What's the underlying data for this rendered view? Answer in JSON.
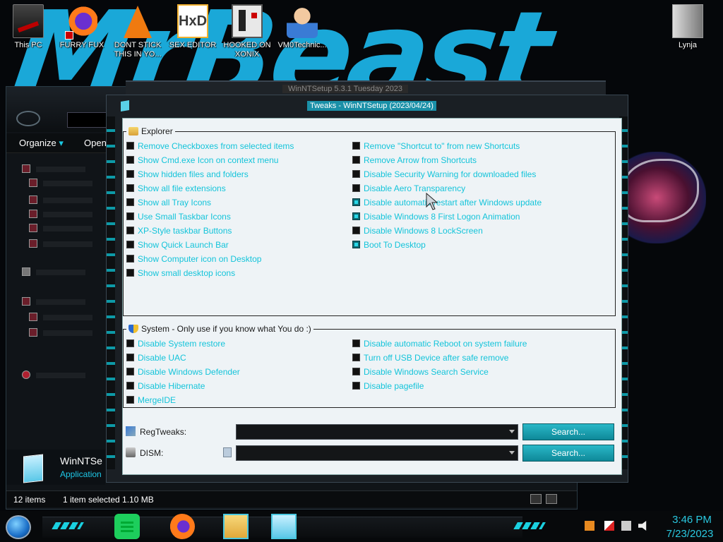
{
  "desktop": {
    "wallpaper_text": "MrBeast",
    "icons": [
      {
        "label": "This PC"
      },
      {
        "label": "FURRY FUX"
      },
      {
        "label": "DONT STICK THIS IN YO..."
      },
      {
        "label": "SEX EDITOR"
      },
      {
        "label": "HOOKED ON XONIX"
      },
      {
        "label": "VM0Technic..."
      },
      {
        "label": "Lynja"
      }
    ]
  },
  "explorer": {
    "toolbar": {
      "organize": "Organize",
      "open": "Open"
    },
    "details": {
      "name": "WinNTSe",
      "type": "Application"
    },
    "status": {
      "items": "12 items",
      "selected": "1 item selected  1.10 MB"
    }
  },
  "winntsetup": {
    "title": "WinNTSetup 5.3.1                    Tuesday 2023"
  },
  "tweaks": {
    "title": "Tweaks - WinNTSetup (2023/04/24)",
    "explorer_group": {
      "label": "Explorer",
      "left": [
        {
          "label": "Remove Checkboxes from selected items",
          "checked": false
        },
        {
          "label": "Show Cmd.exe Icon on context menu",
          "checked": false
        },
        {
          "label": "Show hidden files and folders",
          "checked": false
        },
        {
          "label": "Show all file extensions",
          "checked": false
        },
        {
          "label": "Show all Tray Icons",
          "checked": false
        },
        {
          "label": "Use Small Taskbar Icons",
          "checked": false
        },
        {
          "label": "XP-Style taskbar Buttons",
          "checked": false
        },
        {
          "label": "Show Quick Launch Bar",
          "checked": false
        },
        {
          "label": "Show Computer icon on Desktop",
          "checked": false
        },
        {
          "label": "Show small desktop icons",
          "checked": false
        }
      ],
      "right": [
        {
          "label": "Remove \"Shortcut to\" from new Shortcuts",
          "checked": false
        },
        {
          "label": "Remove Arrow from Shortcuts",
          "checked": false
        },
        {
          "label": "Disable Security Warning for downloaded files",
          "checked": false
        },
        {
          "label": "Disable Aero Transparency",
          "checked": false
        },
        {
          "label": "Disable automatic restart after Windows update",
          "checked": true
        },
        {
          "label": "Disable Windows 8 First Logon Animation",
          "checked": true
        },
        {
          "label": "Disable Windows 8 LockScreen",
          "checked": false
        },
        {
          "label": "Boot To Desktop",
          "checked": true
        }
      ]
    },
    "system_group": {
      "label": "System - Only use if you know what You do :)",
      "left": [
        {
          "label": "Disable System restore",
          "checked": false
        },
        {
          "label": "Disable UAC",
          "checked": false
        },
        {
          "label": "Disable Windows Defender",
          "checked": false
        },
        {
          "label": "Disable Hibernate",
          "checked": false
        },
        {
          "label": "MergeIDE",
          "checked": false
        }
      ],
      "right": [
        {
          "label": "Disable automatic Reboot on system failure",
          "checked": false
        },
        {
          "label": "Turn off USB Device after safe remove",
          "checked": false
        },
        {
          "label": "Disable Windows Search Service",
          "checked": false
        },
        {
          "label": "Disable pagefile",
          "checked": false
        }
      ]
    },
    "regtweaks": {
      "label": "RegTweaks:",
      "value": "",
      "button": "Search..."
    },
    "dism": {
      "label": "DISM:",
      "value": "",
      "button": "Search..."
    }
  },
  "taskbar": {
    "time": "3:46 PM",
    "date": "7/23/2023",
    "apps": [
      "spotify",
      "firefox",
      "file-explorer",
      "winntsetup"
    ]
  },
  "colors": {
    "accent": "#14c4da",
    "title_bg": "#1a90a8",
    "clock": "#2ac8e0"
  }
}
